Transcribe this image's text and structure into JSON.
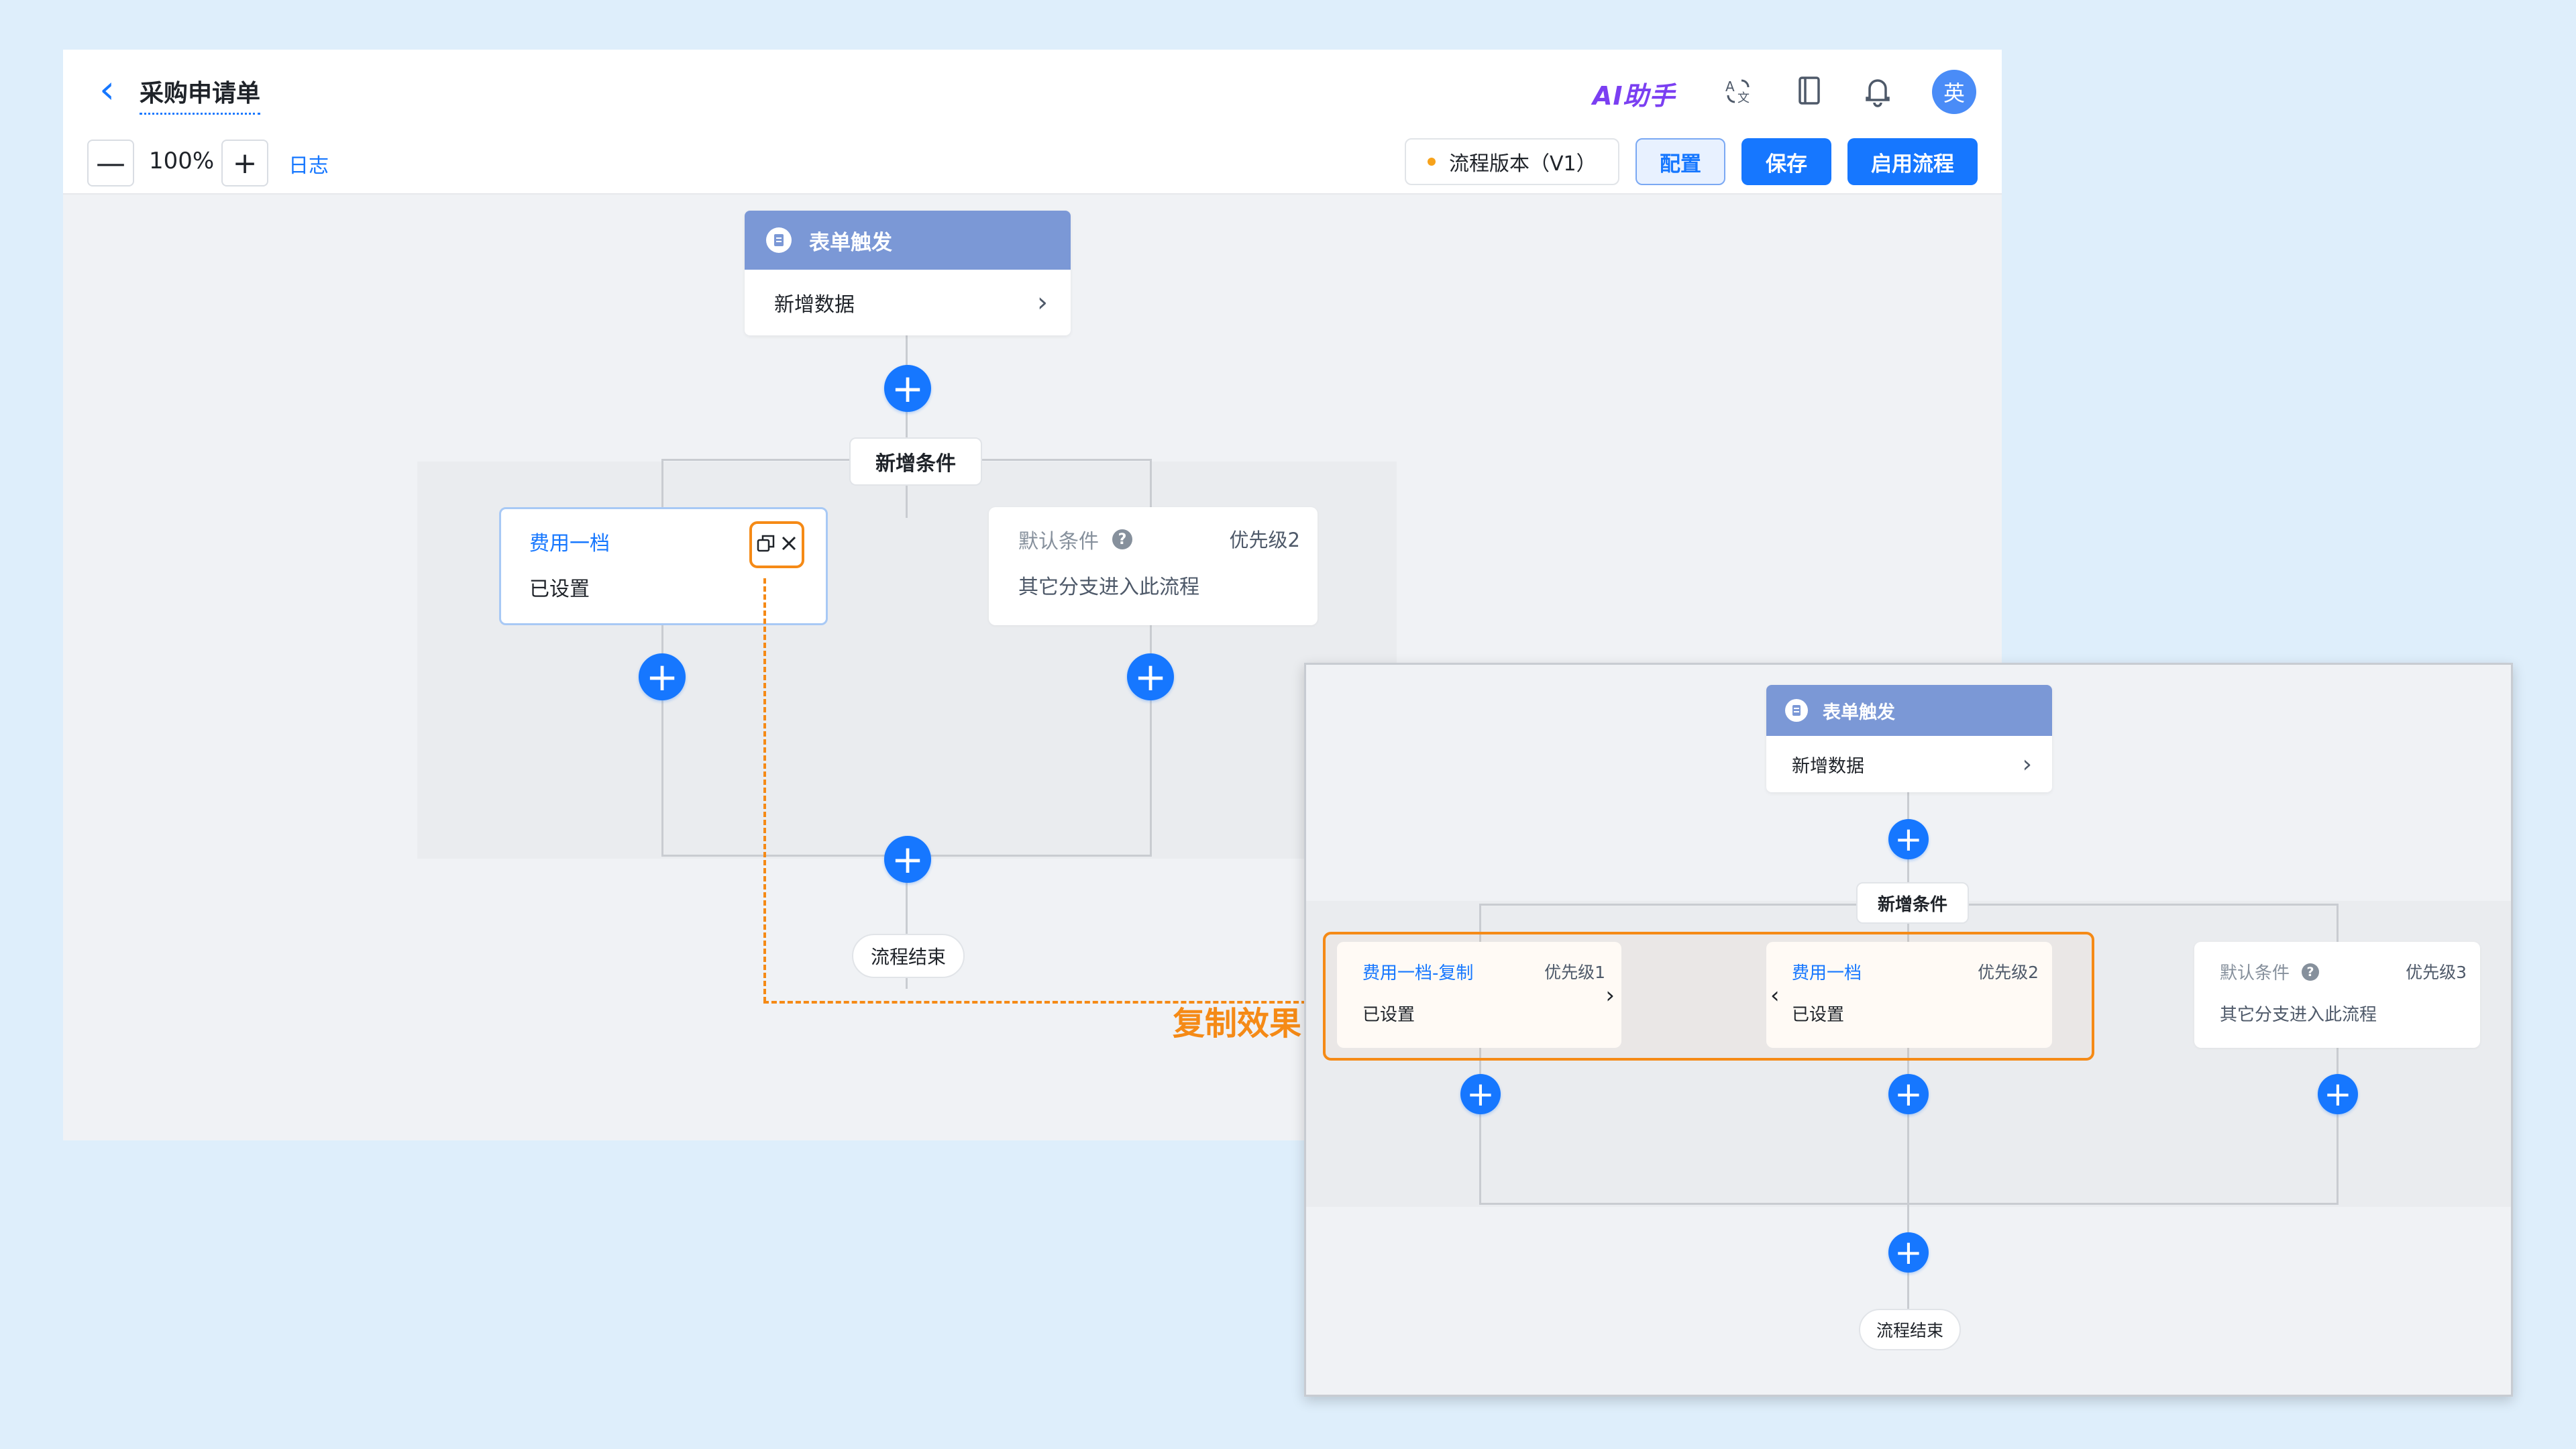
{
  "header": {
    "back_icon": "chevron-left-icon",
    "title": "采购申请单",
    "ai_assistant": "AI助手",
    "icons": [
      "translate-icon",
      "notebook-icon",
      "bell-icon"
    ],
    "avatar_text": "英"
  },
  "toolbar": {
    "zoom_out": "—",
    "zoom_level": "100%",
    "zoom_in": "+",
    "log_link": "日志",
    "version": "流程版本（V1）",
    "config_button": "配置",
    "save_button": "保存",
    "enable_button": "启用流程"
  },
  "flow": {
    "trigger_title": "表单触发",
    "trigger_item": "新增数据",
    "add_condition": "新增条件",
    "branch1": {
      "name": "费用一档",
      "status": "已设置"
    },
    "branch2": {
      "name": "默认条件",
      "priority": "优先级2",
      "desc": "其它分支进入此流程"
    },
    "end": "流程结束"
  },
  "callout": "复制效果",
  "inset": {
    "trigger_title": "表单触发",
    "trigger_item": "新增数据",
    "add_condition": "新增条件",
    "branch1": {
      "name": "费用一档-复制",
      "priority": "优先级1",
      "status": "已设置"
    },
    "branch2": {
      "name": "费用一档",
      "priority": "优先级2",
      "status": "已设置"
    },
    "branch3": {
      "name": "默认条件",
      "priority": "优先级3",
      "desc": "其它分支进入此流程"
    },
    "end": "流程结束"
  },
  "colors": {
    "accent": "#1677ff",
    "highlight": "#f58a16",
    "trigger_header": "#7b98d6"
  }
}
